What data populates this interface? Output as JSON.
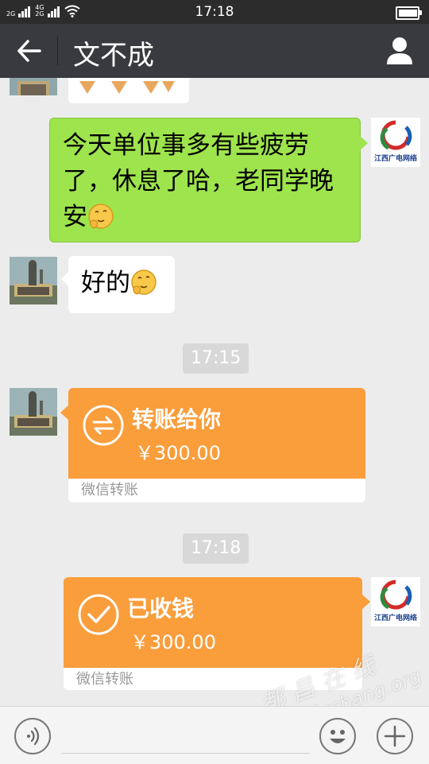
{
  "status_bar": {
    "net1": "2G",
    "net2": "4G",
    "net3": "2G",
    "time": "17:18"
  },
  "header": {
    "title": "文不成"
  },
  "messages": {
    "m1_text": "今天单位事多有些疲劳了，休息了哈，老同学晚安",
    "m2_text": "好的",
    "ts1": "17:15",
    "ts2": "17:18",
    "self_avatar_text": "江西广电网络"
  },
  "transfer_sent": {
    "title": "转账给你",
    "amount": "￥300.00",
    "footer": "微信转账"
  },
  "transfer_received": {
    "title": "已收钱",
    "amount": "￥300.00",
    "footer": "微信转账"
  },
  "watermark": {
    "line1": "都昌在线",
    "line2": "www.duchang.org"
  },
  "colors": {
    "title_bar": "#393a3f",
    "sent_bubble": "#9ee44d",
    "transfer": "#fa9d3b",
    "background": "#ececec"
  }
}
